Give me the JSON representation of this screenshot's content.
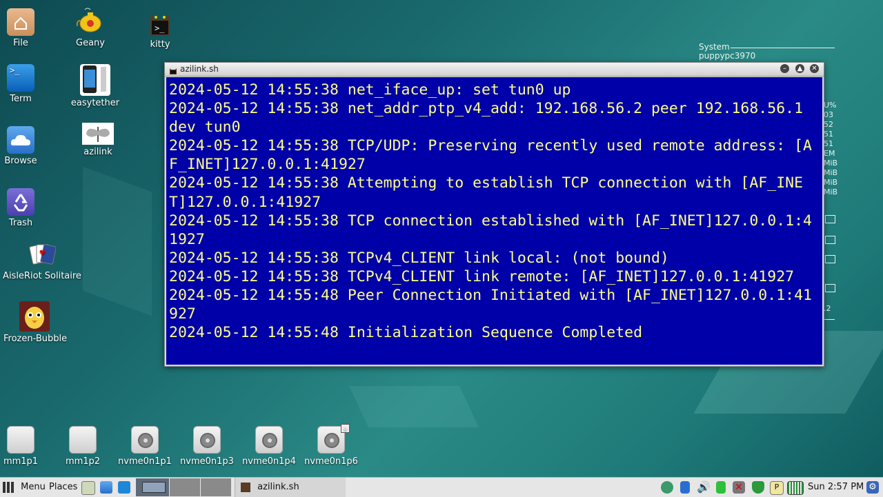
{
  "desktop": {
    "icons": [
      {
        "label": "File",
        "icon": "folder-home-icon"
      },
      {
        "label": "Geany",
        "icon": "teapot-icon"
      },
      {
        "label": "kitty",
        "icon": "kitty-terminal-icon"
      },
      {
        "label": "Term",
        "icon": "terminal-icon"
      },
      {
        "label": "easytether",
        "icon": "phone-icon"
      },
      {
        "label": "Browse",
        "icon": "cloud-icon"
      },
      {
        "label": "azilink",
        "icon": "moth-icon"
      },
      {
        "label": "Trash",
        "icon": "recycle-icon"
      },
      {
        "label": "AisleRiot Solitaire",
        "icon": "cards-icon"
      },
      {
        "label": "Frozen-Bubble",
        "icon": "penguin-icon"
      }
    ],
    "drives": [
      {
        "label": "mm1p1"
      },
      {
        "label": "mm1p2"
      },
      {
        "label": "nvme0n1p1"
      },
      {
        "label": "nvme0n1p3"
      },
      {
        "label": "nvme0n1p4"
      },
      {
        "label": "nvme0n1p6"
      }
    ],
    "conky": {
      "heading": "System",
      "host": "puppypc3970",
      "side_values": [
        "U%",
        "03",
        "52",
        "51",
        "51",
        "EM",
        "MiB",
        "MiB",
        "MiB",
        "MiB",
        ".2"
      ]
    }
  },
  "window": {
    "title": "azilink.sh",
    "lines": [
      "2024-05-12 14:55:38 net_iface_up: set tun0 up",
      "2024-05-12 14:55:38 net_addr_ptp_v4_add: 192.168.56.2 peer 192.168.56.1 dev tun0",
      "2024-05-12 14:55:38 TCP/UDP: Preserving recently used remote address: [AF_INET]127.0.0.1:41927",
      "2024-05-12 14:55:38 Attempting to establish TCP connection with [AF_INET]127.0.0.1:41927",
      "2024-05-12 14:55:38 TCP connection established with [AF_INET]127.0.0.1:41927",
      "2024-05-12 14:55:38 TCPv4_CLIENT link local: (not bound)",
      "2024-05-12 14:55:38 TCPv4_CLIENT link remote: [AF_INET]127.0.0.1:41927",
      "2024-05-12 14:55:48 Peer Connection Initiated with [AF_INET]127.0.0.1:41927",
      "2024-05-12 14:55:48 Initialization Sequence Completed"
    ],
    "colors": {
      "background": "#0000a8",
      "text": "#ffff8c"
    }
  },
  "taskbar": {
    "menu_label": "Menu",
    "places_label": "Places",
    "task_label": "azilink.sh",
    "clock": "Sun  2:57 PM"
  }
}
